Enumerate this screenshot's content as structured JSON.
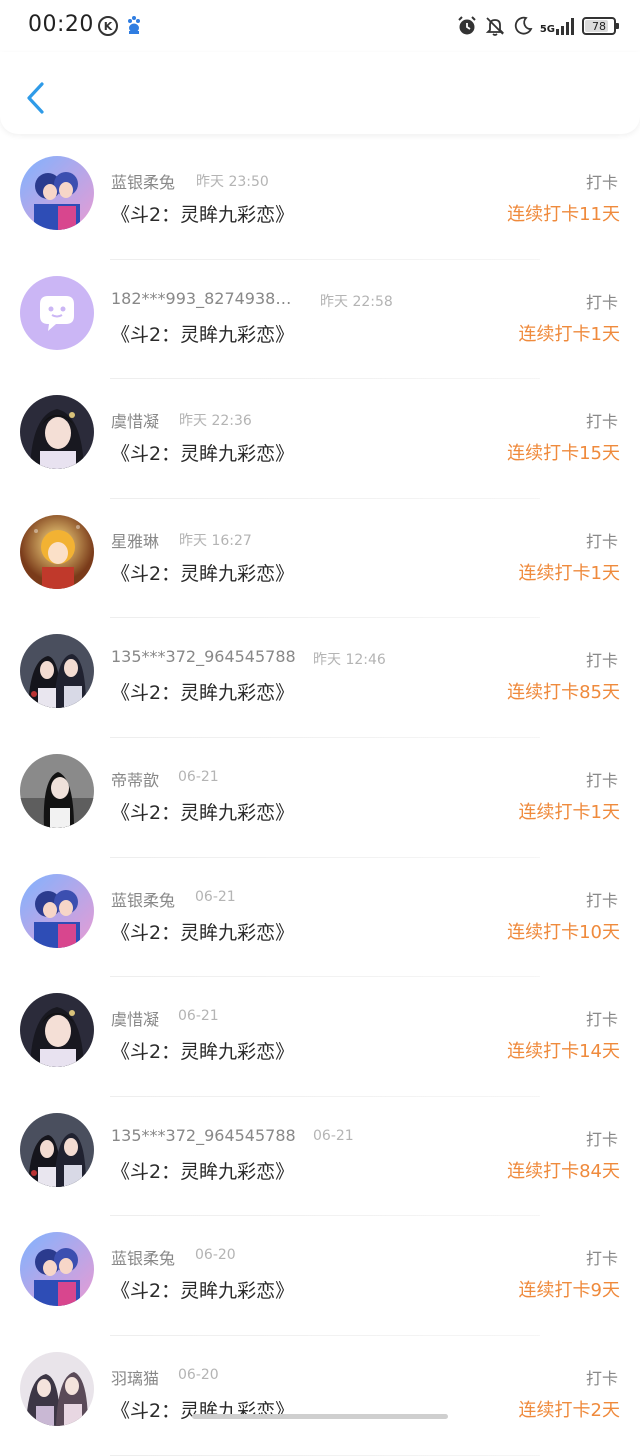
{
  "status_bar": {
    "time": "00:20",
    "k_icon_label": "K",
    "icons": [
      "k-circle-icon",
      "baidu-paw-icon",
      "alarm-icon",
      "mute-bell-icon",
      "moon-icon",
      "5g-signal-icon",
      "battery-icon"
    ],
    "network": "5G",
    "battery": "78"
  },
  "nav": {
    "back_icon": "chevron-left-icon",
    "accent": "#2f9be8"
  },
  "colors": {
    "streak": "#ef8a3c",
    "meta": "#888888",
    "time": "#b4b4b4"
  },
  "items": [
    {
      "name": "蓝银柔兔",
      "time": "昨天 23:50",
      "title": "《斗2：灵眸九彩恋》",
      "type": "打卡",
      "streak": "连续打卡11天",
      "avatar": "anime-couple-avatar"
    },
    {
      "name": "182***993_8274938…",
      "time": "昨天 22:58",
      "title": "《斗2：灵眸九彩恋》",
      "type": "打卡",
      "streak": "连续打卡1天",
      "avatar": "default-chat-avatar"
    },
    {
      "name": "虞惜凝",
      "time": "昨天 22:36",
      "title": "《斗2：灵眸九彩恋》",
      "type": "打卡",
      "streak": "连续打卡15天",
      "avatar": "ancient-lady-avatar"
    },
    {
      "name": "星雅琳",
      "time": "昨天 16:27",
      "title": "《斗2：灵眸九彩恋》",
      "type": "打卡",
      "streak": "连续打卡1天",
      "avatar": "golden-girl-avatar"
    },
    {
      "name": "135***372_964545788",
      "time": "昨天 12:46",
      "title": "《斗2：灵眸九彩恋》",
      "type": "打卡",
      "streak": "连续打卡85天",
      "avatar": "ancient-couple-avatar"
    },
    {
      "name": "帝蒂歆",
      "time": "06-21",
      "title": "《斗2：灵眸九彩恋》",
      "type": "打卡",
      "streak": "连续打卡1天",
      "avatar": "girl-portrait-avatar"
    },
    {
      "name": "蓝银柔兔",
      "time": "06-21",
      "title": "《斗2：灵眸九彩恋》",
      "type": "打卡",
      "streak": "连续打卡10天",
      "avatar": "anime-couple-avatar"
    },
    {
      "name": "虞惜凝",
      "time": "06-21",
      "title": "《斗2：灵眸九彩恋》",
      "type": "打卡",
      "streak": "连续打卡14天",
      "avatar": "ancient-lady-avatar"
    },
    {
      "name": "135***372_964545788",
      "time": "06-21",
      "title": "《斗2：灵眸九彩恋》",
      "type": "打卡",
      "streak": "连续打卡84天",
      "avatar": "ancient-couple-avatar"
    },
    {
      "name": "蓝银柔兔",
      "time": "06-20",
      "title": "《斗2：灵眸九彩恋》",
      "type": "打卡",
      "streak": "连续打卡9天",
      "avatar": "anime-couple-avatar"
    },
    {
      "name": "羽璃猫",
      "time": "06-20",
      "title": "《斗2：灵眸九彩恋》",
      "type": "打卡",
      "streak": "连续打卡2天",
      "avatar": "ancient-pair-avatar"
    }
  ]
}
